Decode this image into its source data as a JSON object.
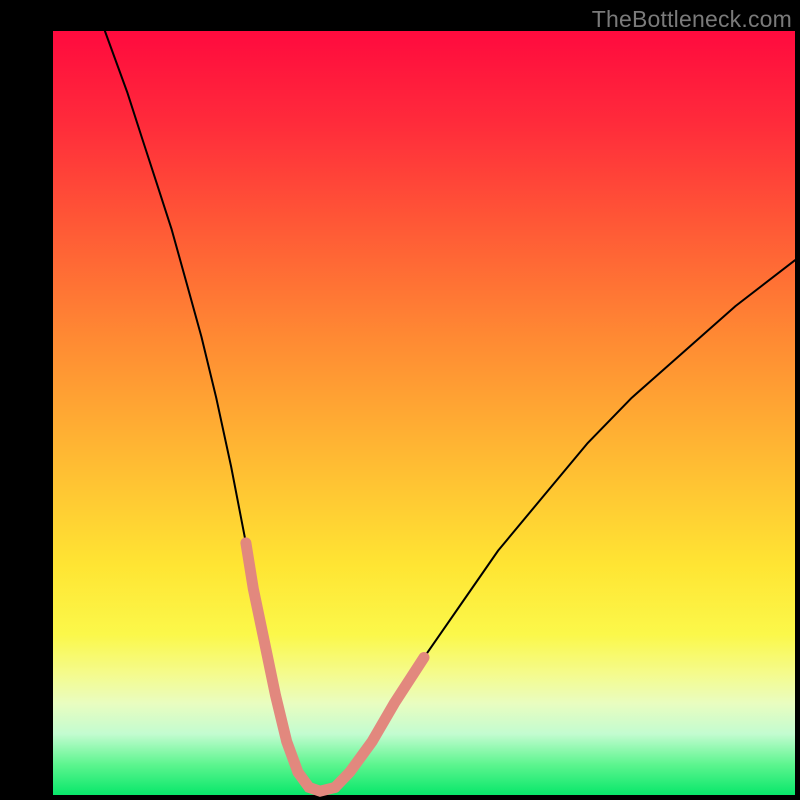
{
  "watermark": "TheBottleneck.com",
  "chart_data": {
    "type": "line",
    "title": "",
    "xlabel": "",
    "ylabel": "",
    "xlim": [
      0,
      100
    ],
    "ylim": [
      0,
      100
    ],
    "grid": false,
    "legend": false,
    "series": [
      {
        "name": "bottleneck-curve",
        "x": [
          7,
          10,
          12,
          14,
          16,
          18,
          20,
          22,
          24,
          26,
          27,
          28.5,
          30,
          31.5,
          33,
          34.5,
          36,
          38,
          40,
          43,
          46,
          50,
          55,
          60,
          66,
          72,
          78,
          85,
          92,
          100
        ],
        "values": [
          100,
          92,
          86,
          80,
          74,
          67,
          60,
          52,
          43,
          33,
          27,
          20,
          13,
          7,
          3,
          1,
          0.5,
          1,
          3,
          7,
          12,
          18,
          25,
          32,
          39,
          46,
          52,
          58,
          64,
          70
        ]
      },
      {
        "name": "highlight-left",
        "x": [
          26,
          27,
          28.5,
          30,
          31.5,
          33
        ],
        "values": [
          33,
          27,
          20,
          13,
          7,
          3
        ]
      },
      {
        "name": "highlight-bottom",
        "x": [
          33,
          34.5,
          36,
          38
        ],
        "values": [
          3,
          1,
          0.5,
          1
        ]
      },
      {
        "name": "highlight-right",
        "x": [
          38,
          40,
          43,
          46,
          50
        ],
        "values": [
          1,
          3,
          7,
          12,
          18
        ]
      }
    ],
    "colors": {
      "curve": "#000000",
      "highlight": "#e2887e"
    }
  }
}
